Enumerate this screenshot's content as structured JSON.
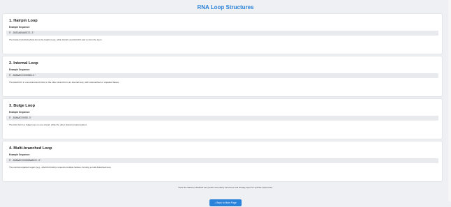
{
  "page": {
    "title": "RNA Loop Structures"
  },
  "sections": [
    {
      "title": "1. Hairpin Loop",
      "sequence_label": "Example Sequence:",
      "sequence": "5'-GGGCAAUAAGCCC-3'",
      "description": "The bolded GAUUAAAGA forms the hairpin loop, while GGGC and AGCCC pair to form the stem."
    },
    {
      "title": "2. Internal Loop",
      "sequence_label": "Example Sequence:",
      "sequence": "5'-GGAAACCCUUUGGG-3'",
      "description": "The AAACCC in one strand and GGG in the other strand form an internal loop, with mismatched or unpaired bases."
    },
    {
      "title": "3. Bulge Loop",
      "sequence_label": "Example Sequence:",
      "sequence": "5'-GGAAACCUUGG-3'",
      "description": "The AAA forms a bulge loop on one strand, while the other strand remains paired."
    },
    {
      "title": "4. Multi-branched Loop",
      "sequence_label": "Example Sequence:",
      "sequence": "5'-GGAAACCUUGGGAAACCC-3'",
      "description": "The central unpaired region (e.g., AAACCCGGG) connects multiple helices, forming a multi-branched loop."
    }
  ],
  "footer": {
    "note_prefix": "Tools like ",
    "tool1": "Mfold",
    "note_mid": " or ",
    "tool2": "RNAfold",
    "note_suffix": " can predict secondary structures and identify loops for specific sequences."
  },
  "back_button": {
    "icon": "home-icon",
    "label": "Back to Main Page"
  }
}
